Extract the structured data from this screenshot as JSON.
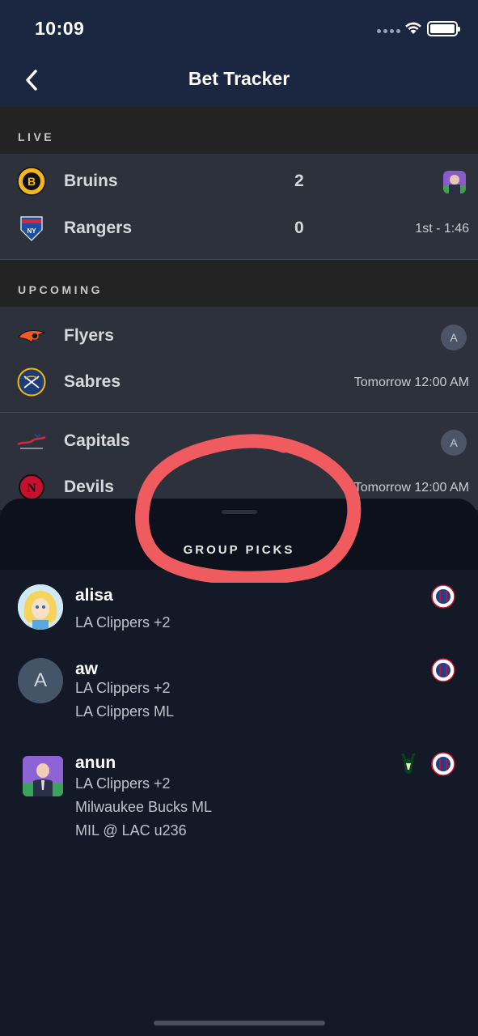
{
  "status_bar": {
    "time": "10:09"
  },
  "nav": {
    "title": "Bet Tracker",
    "back_icon": "chevron-left-icon"
  },
  "sections": {
    "live_label": "LIVE",
    "upcoming_label": "UPCOMING"
  },
  "live_game": {
    "home": {
      "name": "Bruins",
      "score": "2"
    },
    "away": {
      "name": "Rangers",
      "score": "0"
    },
    "clock": "1st  - 1:46"
  },
  "upcoming_games": [
    {
      "team1": "Flyers",
      "team2": "Sabres",
      "badge": "A",
      "time": "Tomorrow 12:00 AM"
    },
    {
      "team1": "Capitals",
      "team2": "Devils",
      "badge": "A",
      "time": "Tomorrow 12:00 AM"
    }
  ],
  "group_picks": {
    "title": "GROUP PICKS",
    "picks": [
      {
        "user": "alisa",
        "lines": [
          "LA Clippers +2"
        ]
      },
      {
        "user": "aw",
        "avatar_letter": "A",
        "lines": [
          "LA Clippers +2",
          "LA Clippers ML"
        ]
      },
      {
        "user": "anun",
        "lines": [
          "LA Clippers +2",
          "Milwaukee Bucks ML",
          "MIL @ LAC u236"
        ]
      }
    ]
  },
  "colors": {
    "nav_bg": "#1b2740",
    "card_bg": "#2d313c",
    "sheet_bg": "#131927",
    "annotation": "#ef5b5f"
  }
}
